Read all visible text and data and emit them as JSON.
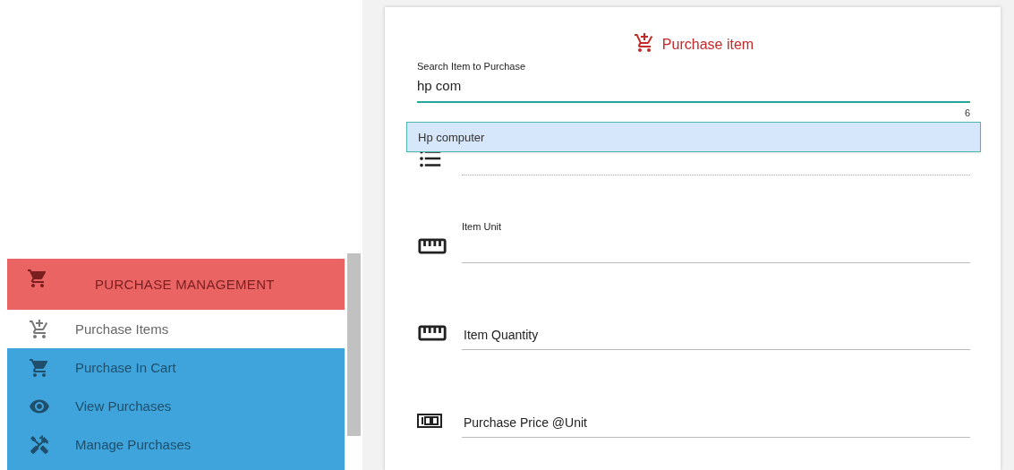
{
  "sidebar": {
    "heading": "PURCHASE MANAGEMENT",
    "items": [
      {
        "label": "Purchase Items",
        "selected": true
      },
      {
        "label": "Purchase In Cart",
        "selected": false
      },
      {
        "label": "View Purchases",
        "selected": false
      },
      {
        "label": "Manage Purchases",
        "selected": false
      }
    ]
  },
  "form": {
    "title": "Purchase item",
    "search": {
      "label": "Search Item to Purchase",
      "value": "hp com",
      "counter": "6"
    },
    "suggestions": [
      {
        "label": "Hp computer",
        "selected": true
      }
    ],
    "fields": [
      {
        "kind": "inactive"
      },
      {
        "kind": "select",
        "label": "Item Unit"
      },
      {
        "kind": "number",
        "placeholder": "Item Quantity"
      },
      {
        "kind": "number",
        "placeholder": "Purchase Price @Unit"
      }
    ]
  }
}
